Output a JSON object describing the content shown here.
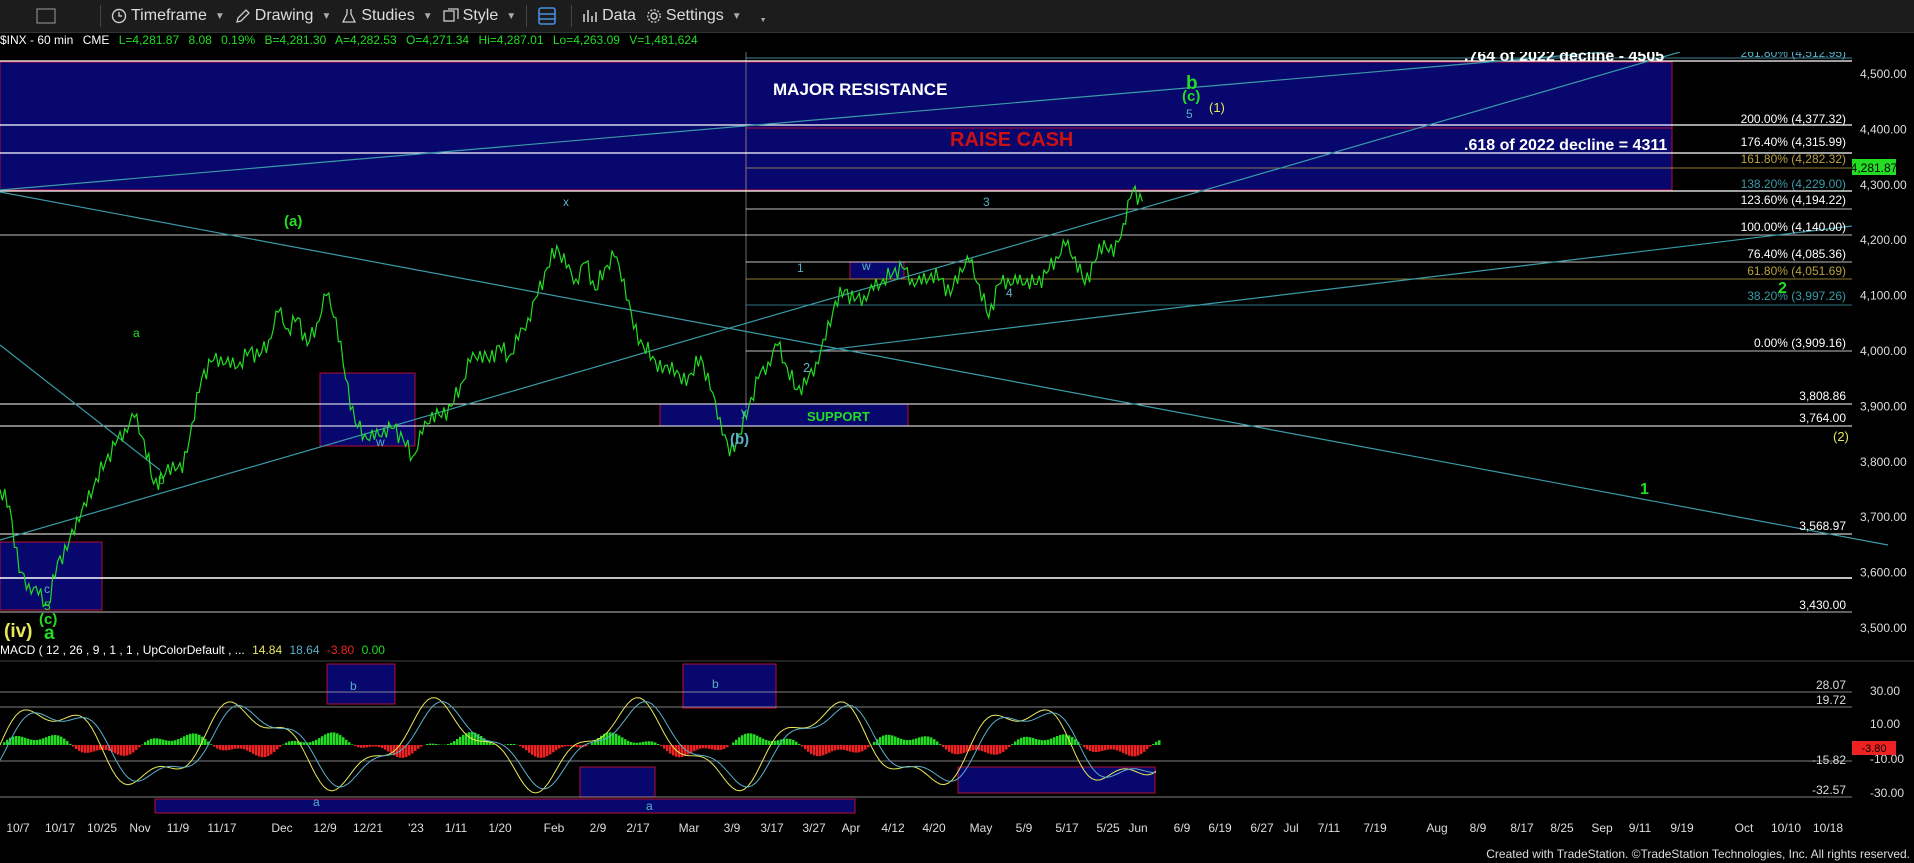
{
  "toolbar": {
    "timeframe": "Timeframe",
    "drawing": "Drawing",
    "studies": "Studies",
    "style": "Style",
    "data": "Data",
    "settings": "Settings"
  },
  "info": {
    "symbol": "$INX - 60 min",
    "exchange": "CME",
    "last": "L=4,281.87",
    "change": "8.08",
    "pct": "0.19%",
    "bid": "B=4,281.30",
    "ask": "A=4,282.53",
    "open": "O=4,271.34",
    "high": "Hi=4,287.01",
    "low": "Lo=4,263.09",
    "volume": "V=1,481,624"
  },
  "macd_info": {
    "label": "MACD ( 12 , 26 , 9 , 1 , 1 , UpColorDefault , ...",
    "v1": "14.84",
    "v2": "18.64",
    "v3": "-3.80",
    "v4": "0.00"
  },
  "footer": "Created with TradeStation. ©TradeStation Technologies, Inc. All rights reserved.",
  "chart_data": {
    "type": "line",
    "series_color": "#22dd22",
    "price_axis": [
      "4,500.00",
      "4,400.00",
      "4,300.00",
      "4,200.00",
      "4,100.00",
      "4,000.00",
      "3,900.00",
      "3,800.00",
      "3,700.00",
      "3,600.00",
      "3,500.00"
    ],
    "last_price": "4,281.87",
    "x_ticks": [
      "10/7",
      "10/17",
      "10/25",
      "Nov",
      "11/9",
      "11/17",
      "Dec",
      "12/9",
      "12/21",
      "'23",
      "1/11",
      "1/20",
      "Feb",
      "2/9",
      "2/17",
      "Mar",
      "3/9",
      "3/17",
      "3/27",
      "Apr",
      "4/12",
      "4/20",
      "May",
      "5/9",
      "5/17",
      "5/25",
      "Jun",
      "6/9",
      "6/19",
      "6/27",
      "Jul",
      "7/11",
      "7/19",
      "Aug",
      "8/9",
      "8/17",
      "8/25",
      "Sep",
      "9/11",
      "9/19",
      "Oct",
      "10/10",
      "10/18"
    ],
    "price_path": [
      [
        0,
        3750
      ],
      [
        8,
        3720
      ],
      [
        16,
        3600
      ],
      [
        24,
        3580
      ],
      [
        32,
        3560
      ],
      [
        40,
        3540
      ],
      [
        48,
        3620
      ],
      [
        56,
        3640
      ],
      [
        64,
        3700
      ],
      [
        72,
        3720
      ],
      [
        80,
        3770
      ],
      [
        88,
        3800
      ],
      [
        96,
        3830
      ],
      [
        104,
        3860
      ],
      [
        112,
        3880
      ],
      [
        120,
        3840
      ],
      [
        128,
        3760
      ],
      [
        136,
        3770
      ],
      [
        144,
        3800
      ],
      [
        152,
        3780
      ],
      [
        160,
        3870
      ],
      [
        168,
        3950
      ],
      [
        176,
        3980
      ],
      [
        184,
        3990
      ],
      [
        192,
        3970
      ],
      [
        200,
        3980
      ],
      [
        208,
        4000
      ],
      [
        216,
        3990
      ],
      [
        224,
        4020
      ],
      [
        232,
        4070
      ],
      [
        240,
        4040
      ],
      [
        248,
        4060
      ],
      [
        256,
        4010
      ],
      [
        264,
        4050
      ],
      [
        272,
        4100
      ],
      [
        280,
        4060
      ],
      [
        288,
        3950
      ],
      [
        296,
        3870
      ],
      [
        304,
        3850
      ],
      [
        312,
        3840
      ],
      [
        320,
        3860
      ],
      [
        328,
        3860
      ],
      [
        336,
        3840
      ],
      [
        344,
        3810
      ],
      [
        352,
        3850
      ],
      [
        360,
        3890
      ],
      [
        368,
        3880
      ],
      [
        376,
        3900
      ],
      [
        384,
        3940
      ],
      [
        392,
        3980
      ],
      [
        400,
        4000
      ],
      [
        408,
        3980
      ],
      [
        416,
        4010
      ],
      [
        424,
        3990
      ],
      [
        432,
        4020
      ],
      [
        440,
        4060
      ],
      [
        448,
        4100
      ],
      [
        456,
        4150
      ],
      [
        464,
        4190
      ],
      [
        472,
        4150
      ],
      [
        480,
        4130
      ],
      [
        488,
        4160
      ],
      [
        496,
        4110
      ],
      [
        504,
        4150
      ],
      [
        512,
        4170
      ],
      [
        520,
        4130
      ],
      [
        528,
        4040
      ],
      [
        536,
        4010
      ],
      [
        544,
        3990
      ],
      [
        552,
        3960
      ],
      [
        560,
        3980
      ],
      [
        568,
        3940
      ],
      [
        576,
        3960
      ],
      [
        584,
        3990
      ],
      [
        592,
        3930
      ],
      [
        600,
        3880
      ],
      [
        608,
        3810
      ],
      [
        616,
        3850
      ],
      [
        624,
        3900
      ],
      [
        632,
        3950
      ],
      [
        640,
        3980
      ],
      [
        648,
        4010
      ],
      [
        656,
        3970
      ],
      [
        664,
        3930
      ],
      [
        672,
        3940
      ],
      [
        680,
        3980
      ],
      [
        688,
        4020
      ],
      [
        696,
        4090
      ],
      [
        704,
        4110
      ],
      [
        712,
        4090
      ],
      [
        720,
        4100
      ],
      [
        728,
        4110
      ],
      [
        736,
        4130
      ],
      [
        744,
        4140
      ],
      [
        752,
        4150
      ],
      [
        760,
        4130
      ],
      [
        768,
        4120
      ],
      [
        776,
        4140
      ],
      [
        784,
        4130
      ],
      [
        792,
        4100
      ],
      [
        800,
        4150
      ],
      [
        808,
        4160
      ],
      [
        816,
        4120
      ],
      [
        824,
        4060
      ],
      [
        832,
        4120
      ],
      [
        840,
        4130
      ],
      [
        848,
        4120
      ],
      [
        856,
        4130
      ],
      [
        864,
        4120
      ],
      [
        872,
        4140
      ],
      [
        880,
        4170
      ],
      [
        888,
        4190
      ],
      [
        896,
        4170
      ],
      [
        904,
        4120
      ],
      [
        912,
        4160
      ],
      [
        920,
        4200
      ],
      [
        928,
        4170
      ],
      [
        936,
        4230
      ],
      [
        944,
        4290
      ],
      [
        952,
        4270
      ]
    ],
    "annotations": [
      {
        "text": "MAJOR RESISTANCE",
        "color": "#ffffff"
      },
      {
        "text": "RAISE CASH",
        "color": "#cc1111"
      },
      {
        "text": ".764 of 2022 decline - 4505",
        "color": "#ffffff"
      },
      {
        "text": ".618 of 2022 decline = 4311",
        "color": "#ffffff"
      },
      {
        "text": "SUPPORT",
        "color": "#22dd22"
      }
    ],
    "fib_levels": [
      {
        "label": "261.80% (4,512.95)",
        "color": "#5ab0c8"
      },
      {
        "label": "200.00% (4,377.32)",
        "color": "#ffffff"
      },
      {
        "label": "176.40% (4,315.99)",
        "color": "#ffffff"
      },
      {
        "label": "161.80% (4,282.32)",
        "color": "#b8a040"
      },
      {
        "label": "138.20% (4,229.00)",
        "color": "#3a9aa8"
      },
      {
        "label": "123.60% (4,194.22)",
        "color": "#ffffff"
      },
      {
        "label": "100.00% (4,140.00)",
        "color": "#ffffff"
      },
      {
        "label": "76.40% (4,085.36)",
        "color": "#ffffff"
      },
      {
        "label": "61.80% (4,051.69)",
        "color": "#b8a040"
      },
      {
        "label": "38.20% (3,997.26)",
        "color": "#3a9aa8"
      },
      {
        "label": "0.00% (3,909.16)",
        "color": "#ffffff"
      },
      {
        "label": "3,808.86",
        "color": "#ffffff"
      },
      {
        "label": "3,764.00",
        "color": "#ffffff"
      },
      {
        "label": "3,568.97",
        "color": "#ffffff"
      },
      {
        "label": "3,430.00",
        "color": "#ffffff"
      }
    ],
    "wave_labels": [
      "(a)",
      "a",
      "b",
      "x",
      "(b)",
      "y",
      "w",
      "1",
      "2",
      "3",
      "4",
      "5",
      "(c)",
      "b",
      "(1)",
      "(2)",
      "1",
      "2",
      "(iv)",
      "c",
      "5",
      "(c)",
      "a",
      "w"
    ],
    "macd_axis": [
      "30.00",
      "10.00",
      "-10.00",
      "-30.00"
    ],
    "macd_levels": [
      "28.07",
      "19.72",
      "-15.82",
      "-32.57"
    ],
    "macd_current": "-3.80",
    "macd_box_labels": [
      "b",
      "b",
      "a",
      "a"
    ]
  }
}
